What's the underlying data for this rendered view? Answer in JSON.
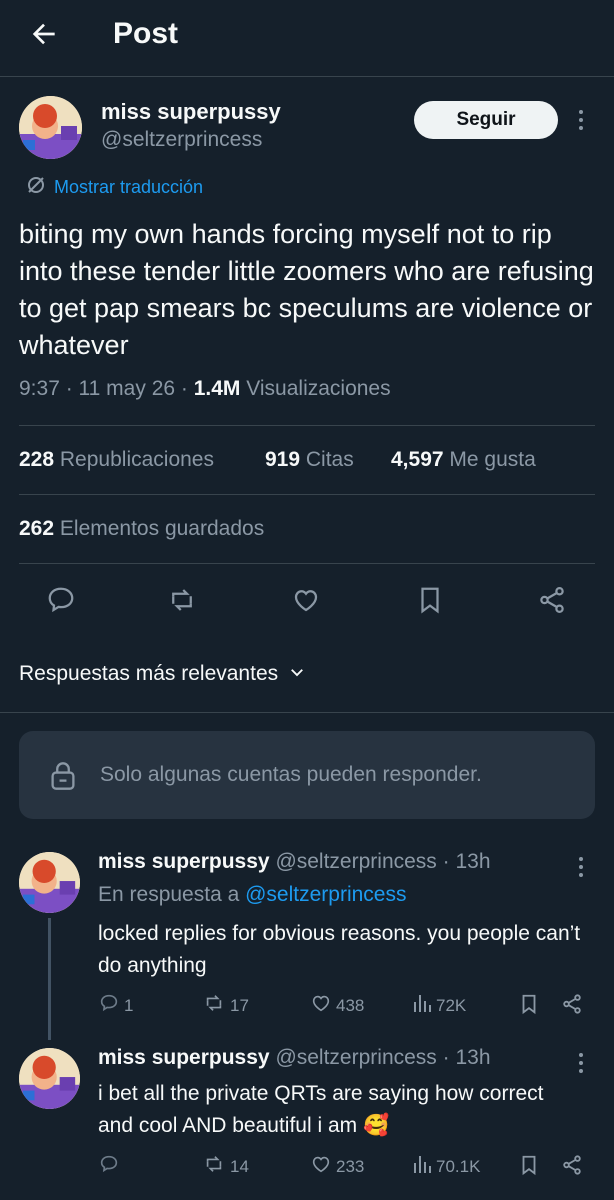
{
  "header": {
    "title": "Post"
  },
  "post": {
    "author_name": "miss superpussy",
    "author_handle": "@seltzerprincess",
    "follow_label": "Seguir",
    "translate_label": "Mostrar traducción",
    "text": "biting my own hands forcing myself not to rip into these tender little zoomers who are refusing to get pap smears bc speculums are violence or whatever",
    "time": "9:37",
    "date": "11 may 26",
    "views_count": "1.4M",
    "views_label": "Visualizaciones",
    "reposts_count": "228",
    "reposts_label": "Republicaciones",
    "quotes_count": "919",
    "quotes_label": "Citas",
    "likes_count": "4,597",
    "likes_label": "Me gusta",
    "bookmarks_count": "262",
    "bookmarks_label": "Elementos guardados"
  },
  "sort": {
    "label": "Respuestas más relevantes"
  },
  "restricted": {
    "text": "Solo algunas cuentas pueden responder."
  },
  "replies": [
    {
      "name": "miss superpussy",
      "handle": "@seltzerprincess",
      "time": "· 13h",
      "in_reply_prefix": "En respuesta a",
      "in_reply_handle": "@seltzerprincess",
      "text": "locked replies for obvious reasons. you people can’t do anything",
      "comments": "1",
      "reposts": "17",
      "likes": "438",
      "views": "72K"
    },
    {
      "name": "miss superpussy",
      "handle": "@seltzerprincess",
      "time": "· 13h",
      "text": "i bet all the private QRTs are saying how correct and cool AND beautiful i am 🥰",
      "comments": "",
      "reposts": "14",
      "likes": "233",
      "views": "70.1K"
    }
  ],
  "colors": {
    "background": "#15202b",
    "accent": "#1d9bf0",
    "text": "#f7f9f9",
    "muted": "#8b98a5",
    "border": "#38444d"
  }
}
